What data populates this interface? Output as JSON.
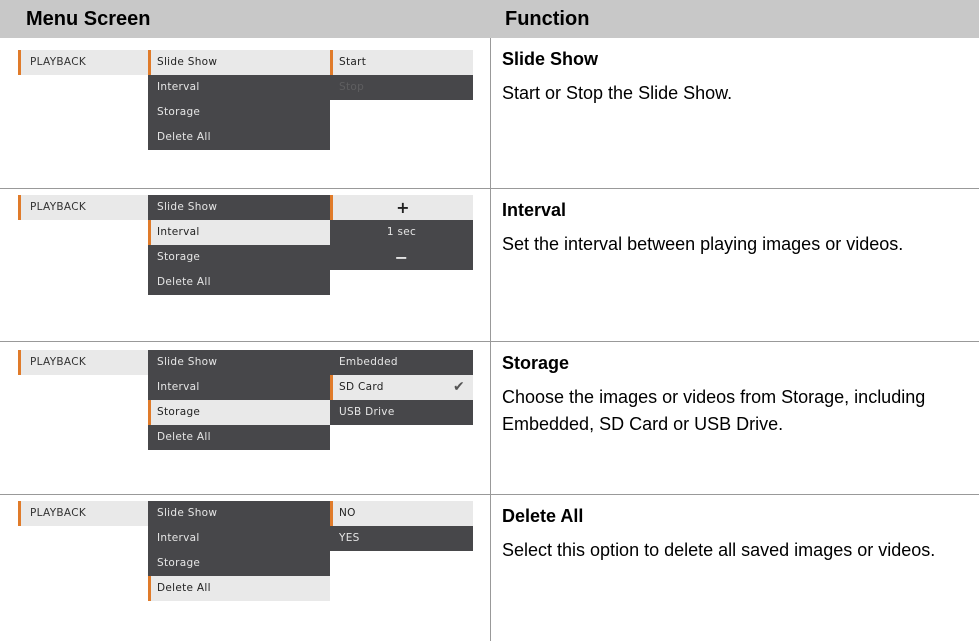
{
  "header": {
    "menu_screen": "Menu Screen",
    "function": "Function"
  },
  "menu": {
    "playback": "PLAYBACK",
    "items": [
      "Slide Show",
      "Interval",
      "Storage",
      "Delete All"
    ]
  },
  "rows": [
    {
      "title": "Slide Show",
      "desc": "Start or Stop the Slide Show.",
      "options": [
        "Start",
        "Stop"
      ]
    },
    {
      "title": "Interval",
      "desc": "Set the interval between playing images or videos.",
      "options": [
        "+",
        "1 sec",
        "−"
      ]
    },
    {
      "title": "Storage",
      "desc": "Choose the images or videos from Storage, including Embedded, SD Card or USB Drive.",
      "options": [
        "Embedded",
        "SD Card",
        "USB Drive"
      ],
      "checked": "SD Card"
    },
    {
      "title": "Delete All",
      "desc": "Select this option to delete all saved images or videos.",
      "options": [
        "NO",
        "YES"
      ]
    }
  ],
  "colors": {
    "accent": "#e07b2a",
    "menu_dark": "#47474a",
    "menu_light": "#e9e9e9",
    "header_bg": "#c8c8c8"
  },
  "icons": {
    "check": "check-icon"
  }
}
